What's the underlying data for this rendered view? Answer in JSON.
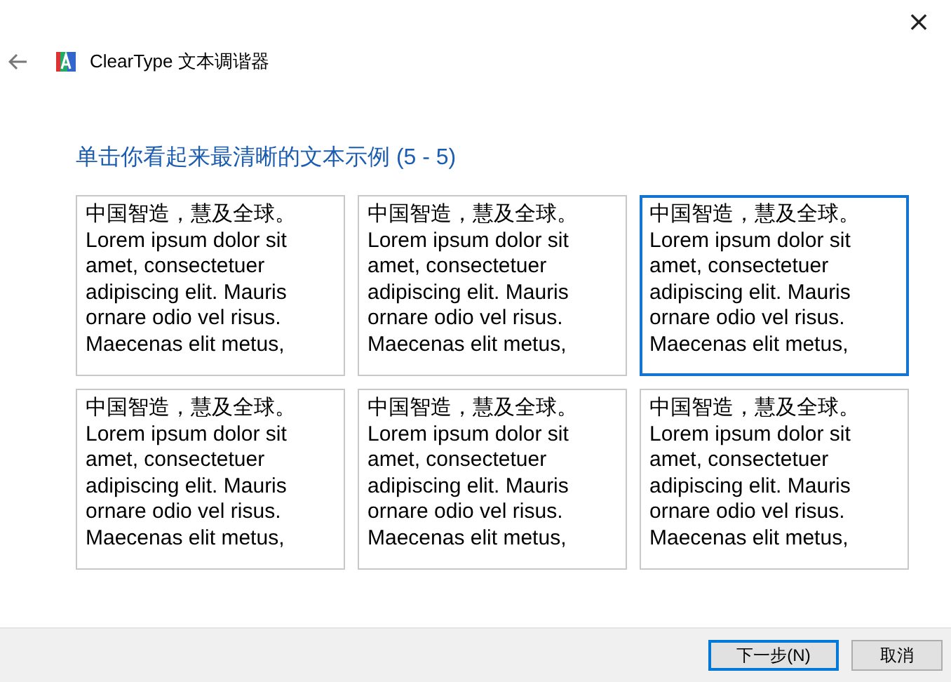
{
  "window": {
    "title": "ClearType 文本调谐器",
    "close": "×"
  },
  "heading": "单击你看起来最清晰的文本示例 (5 - 5)",
  "samples": [
    {
      "selected": false,
      "lines": [
        "中国智造，慧及全球。",
        "Lorem ipsum dolor sit",
        "amet, consectetuer",
        "adipiscing elit. Mauris",
        "ornare odio vel risus.",
        "Maecenas elit metus,"
      ]
    },
    {
      "selected": false,
      "lines": [
        "中国智造，慧及全球。",
        "Lorem ipsum dolor sit",
        "amet, consectetuer",
        "adipiscing elit. Mauris",
        "ornare odio vel risus.",
        "Maecenas elit metus,"
      ]
    },
    {
      "selected": true,
      "lines": [
        "中国智造，慧及全球。",
        "Lorem ipsum dolor sit",
        "amet, consectetuer",
        "adipiscing elit. Mauris",
        "ornare odio vel risus.",
        "Maecenas elit metus,"
      ]
    },
    {
      "selected": false,
      "lines": [
        "中国智造，慧及全球。",
        "Lorem ipsum dolor sit",
        "amet, consectetuer",
        "adipiscing elit. Mauris",
        "ornare odio vel risus.",
        "Maecenas elit metus,"
      ]
    },
    {
      "selected": false,
      "lines": [
        "中国智造，慧及全球。",
        "Lorem ipsum dolor sit",
        "amet, consectetuer",
        "adipiscing elit. Mauris",
        "ornare odio vel risus.",
        "Maecenas elit metus,"
      ]
    },
    {
      "selected": false,
      "lines": [
        "中国智造，慧及全球。",
        "Lorem ipsum dolor sit",
        "amet, consectetuer",
        "adipiscing elit. Mauris",
        "ornare odio vel risus.",
        "Maecenas elit metus,"
      ]
    }
  ],
  "buttons": [
    {
      "label": "下一步(N)",
      "default": true
    },
    {
      "label": "取消",
      "default": false
    }
  ]
}
